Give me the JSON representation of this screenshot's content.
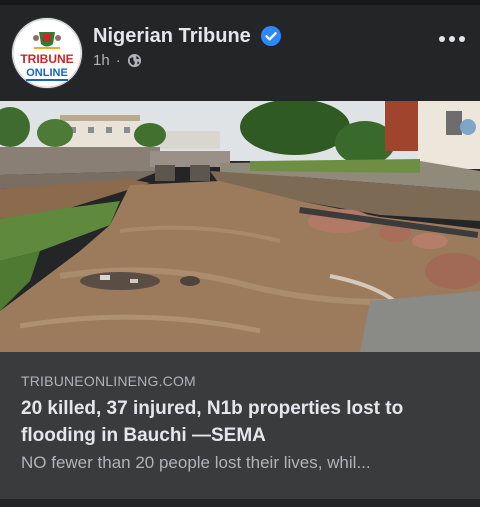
{
  "post": {
    "page_name": "Nigerian Tribune",
    "timestamp": "1h",
    "separator": "·",
    "privacy_icon": "globe-icon",
    "verified_icon": "verified-badge-icon",
    "more_icon": "more-options-icon",
    "logo_text_top": "TRIBUNE",
    "logo_text_bottom": "ONLINE",
    "accent_color": "#2d88ff"
  },
  "link_preview": {
    "domain": "TRIBUNEONLINENG.COM",
    "title": "20 killed, 37 injured, N1b properties lost to flooding in Bauchi —SEMA",
    "description": "NO fewer than 20 people lost their lives, whil..."
  }
}
